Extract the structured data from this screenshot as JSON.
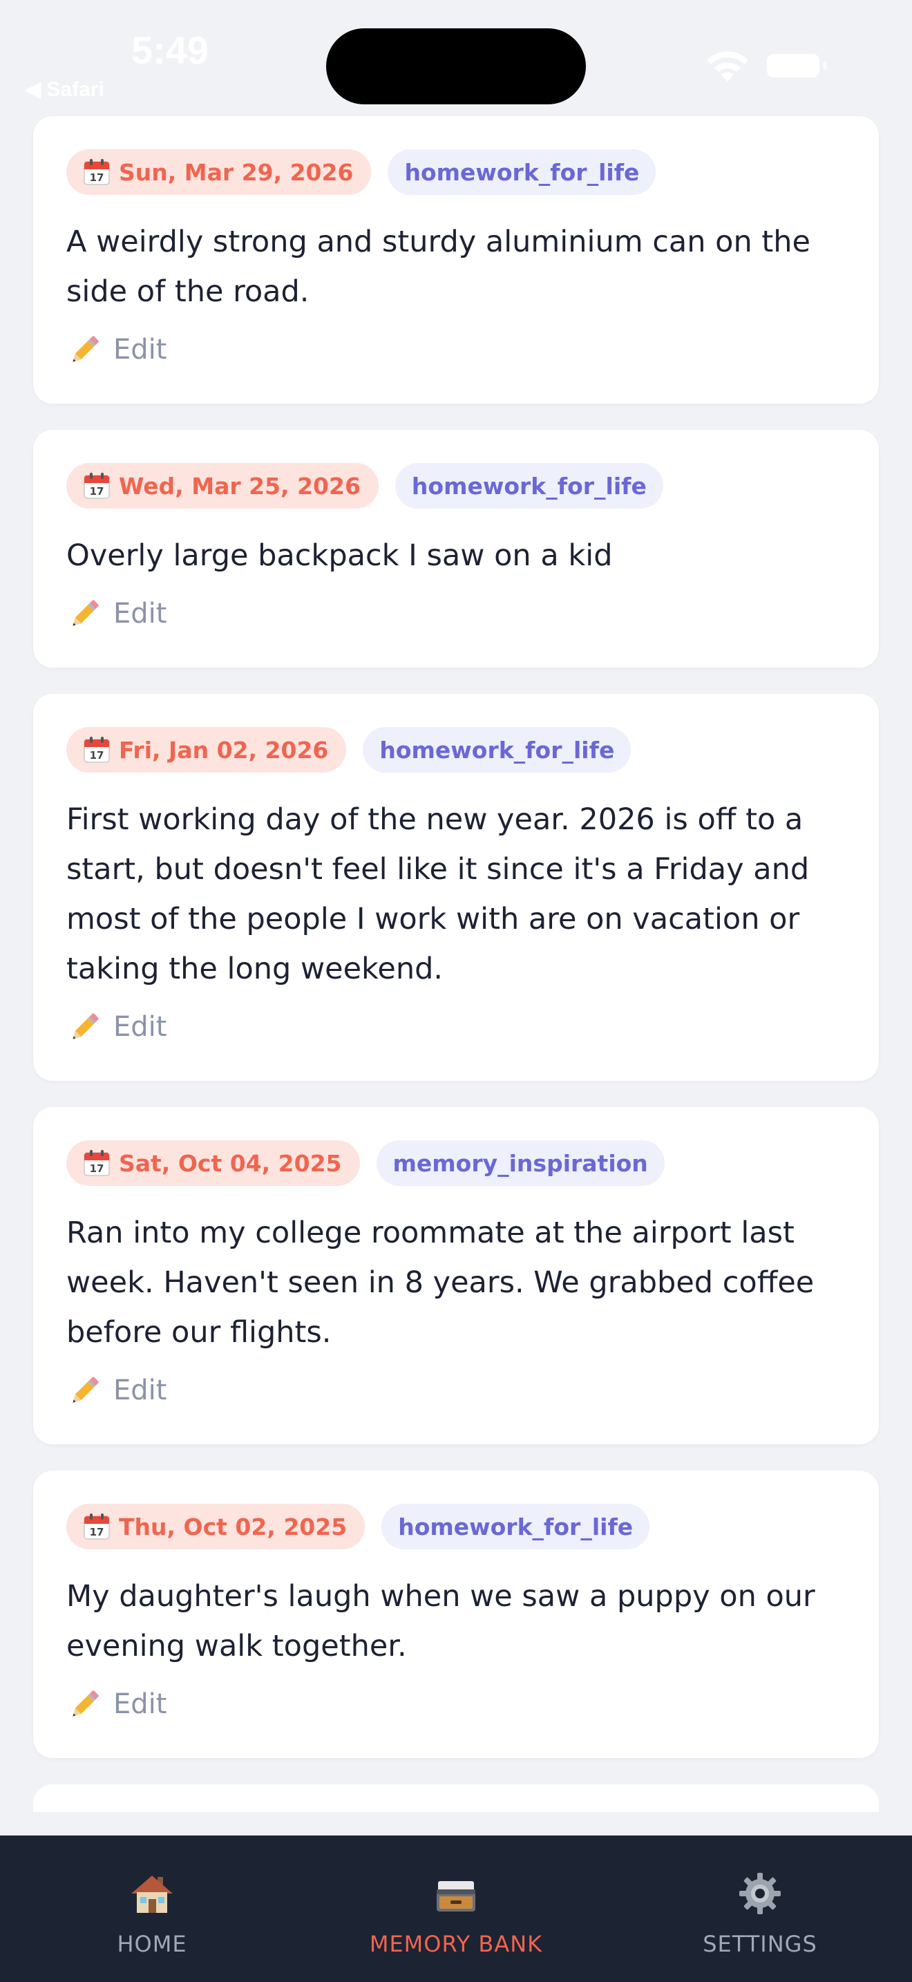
{
  "status_bar": {
    "time": "5:49",
    "back_app": "◀ Safari"
  },
  "memories": [
    {
      "date": "Sun, Mar 29, 2026",
      "tag": "homework_for_life",
      "text": "A weirdly strong and sturdy aluminium can on the side of the road.",
      "edit_label": "Edit"
    },
    {
      "date": "Wed, Mar 25, 2026",
      "tag": "homework_for_life",
      "text": "Overly large backpack I saw on a kid",
      "edit_label": "Edit"
    },
    {
      "date": "Fri, Jan 02, 2026",
      "tag": "homework_for_life",
      "text": "First working day of the new year. 2026 is off to a start, but doesn't feel like it since it's a Friday and most of the people I work with are on vacation or taking the long weekend.",
      "edit_label": "Edit"
    },
    {
      "date": "Sat, Oct 04, 2025",
      "tag": "memory_inspiration",
      "text": "Ran into my college roommate at the airport last week. Haven't seen in 8 years. We grabbed coffee before our flights.",
      "edit_label": "Edit"
    },
    {
      "date": "Thu, Oct 02, 2025",
      "tag": "homework_for_life",
      "text": "My daughter's laugh when we saw a puppy on our evening walk together.",
      "edit_label": "Edit"
    }
  ],
  "tab_bar": {
    "tabs": [
      {
        "label": "HOME",
        "icon": "house-icon"
      },
      {
        "label": "MEMORY BANK",
        "icon": "file-cabinet-icon",
        "active": true
      },
      {
        "label": "SETTINGS",
        "icon": "gear-icon"
      }
    ]
  },
  "colors": {
    "accent": "#f0654f",
    "tag_text": "#6a68d6",
    "tab_bar_bg": "#1c2333",
    "page_bg": "#f1f2f6"
  }
}
